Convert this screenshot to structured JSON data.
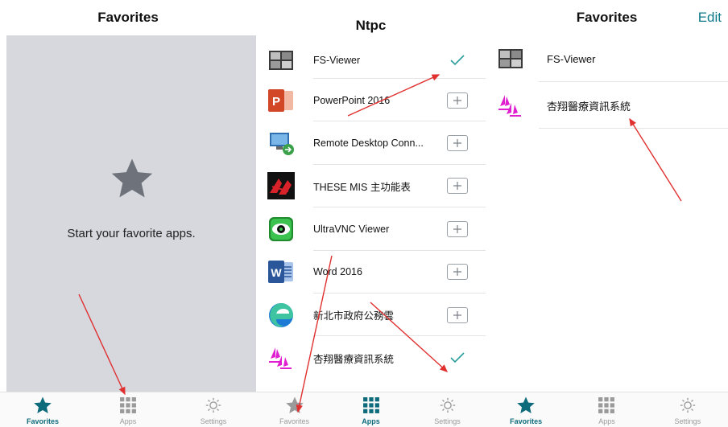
{
  "colors": {
    "accent": "#0d6b7c",
    "edit": "#0d7a8a",
    "check": "#2a9d9d",
    "arrow": "#e03030",
    "empty_bg": "#d6d8de"
  },
  "panel1": {
    "title": "Favorites",
    "empty_message": "Start your favorite apps.",
    "empty_icon": "star-icon",
    "tabs": [
      {
        "label": "Favorites",
        "icon": "star-icon",
        "active": true
      },
      {
        "label": "Apps",
        "icon": "grid-icon",
        "active": false
      },
      {
        "label": "Settings",
        "icon": "gear-icon",
        "active": false
      }
    ]
  },
  "panel2": {
    "title": "Ntpc",
    "apps": [
      {
        "name": "FS-Viewer",
        "icon": "fs-viewer-icon",
        "state": "added"
      },
      {
        "name": "PowerPoint 2016",
        "icon": "powerpoint-icon",
        "state": "add"
      },
      {
        "name": "Remote Desktop Conn...",
        "icon": "remote-desktop-icon",
        "state": "add"
      },
      {
        "name": "THESE MIS 主功能表",
        "icon": "these-mis-icon",
        "state": "add"
      },
      {
        "name": "UltraVNC Viewer",
        "icon": "ultravnc-icon",
        "state": "add"
      },
      {
        "name": "Word 2016",
        "icon": "word-icon",
        "state": "add"
      },
      {
        "name": "新北市政府公務雲",
        "icon": "edge-icon",
        "state": "add"
      },
      {
        "name": "杏翔醫療資訊系統",
        "icon": "medical-system-icon",
        "state": "added"
      }
    ],
    "tabs": [
      {
        "label": "Favorites",
        "icon": "star-icon",
        "active": false
      },
      {
        "label": "Apps",
        "icon": "grid-icon",
        "active": true
      },
      {
        "label": "Settings",
        "icon": "gear-icon",
        "active": false
      }
    ]
  },
  "panel3": {
    "title": "Favorites",
    "edit_label": "Edit",
    "favorites": [
      {
        "name": "FS-Viewer",
        "icon": "fs-viewer-icon"
      },
      {
        "name": "杏翔醫療資訊系統",
        "icon": "medical-system-icon"
      }
    ],
    "tabs": [
      {
        "label": "Favorites",
        "icon": "star-icon",
        "active": true
      },
      {
        "label": "Apps",
        "icon": "grid-icon",
        "active": false
      },
      {
        "label": "Settings",
        "icon": "gear-icon",
        "active": false
      }
    ]
  }
}
